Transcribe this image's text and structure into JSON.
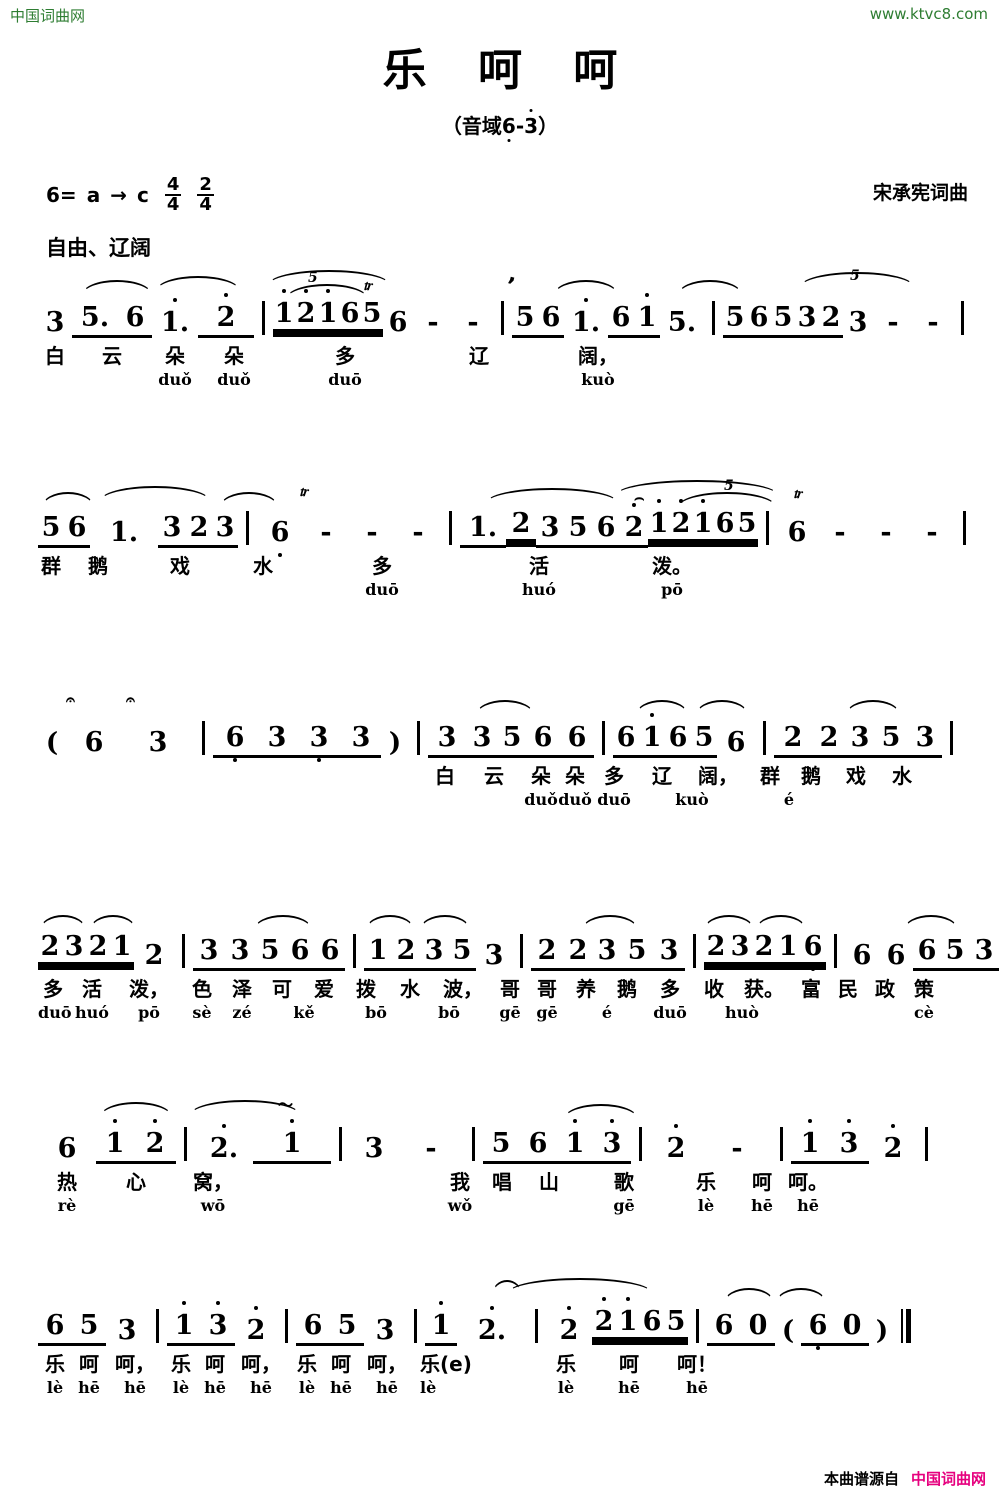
{
  "site": {
    "brand": "中国词曲网",
    "url": "www.ktvc8.com"
  },
  "score": {
    "title": "乐 呵 呵",
    "subtitle_prefix": "（音域",
    "subtitle_low": "6",
    "subtitle_dash": "-",
    "subtitle_high": "3",
    "subtitle_suffix": "）",
    "key": "6=",
    "key_from": "a",
    "key_arrow": "→",
    "key_to": "c",
    "meter1_num": "4",
    "meter1_den": "4",
    "meter2_num": "2",
    "meter2_den": "4",
    "credit": "宋承宪词曲",
    "tempo": "自由、辽阔"
  },
  "lines": [
    {
      "id": "line-1",
      "measures": [
        {
          "notes": [
            "3",
            "5.",
            "6",
            "1.",
            "2"
          ],
          "lyrics": [
            "白",
            "云",
            "朵",
            "",
            "朵"
          ],
          "pinyin": [
            "",
            "",
            "duǒ",
            "",
            "duǒ"
          ]
        },
        {
          "notes": [
            "1",
            "2",
            "1",
            "6",
            "5",
            "6",
            "-",
            "-"
          ],
          "lyrics": [],
          "pinyin": []
        },
        {
          "notes": [
            "5",
            "6",
            "1.",
            "6",
            "1",
            "5."
          ],
          "lyrics": [
            "多",
            "",
            "",
            "辽"
          ],
          "pinyin": [
            "duō",
            "",
            "",
            "kuò"
          ]
        },
        {
          "notes": [
            "5",
            "6",
            "5",
            "3",
            "2",
            "3",
            "-",
            "-"
          ],
          "lyrics": [
            "阔，"
          ],
          "pinyin": [
            "kuò"
          ]
        }
      ]
    },
    {
      "id": "line-2",
      "measures": [
        {
          "notes": [
            "5",
            "6",
            "1.",
            "3",
            "2",
            "3"
          ],
          "lyrics": [
            "群",
            "鹅",
            "戏"
          ],
          "pinyin": []
        },
        {
          "notes": [
            "6",
            "-",
            "-",
            "-"
          ],
          "lyrics": [
            "水"
          ],
          "pinyin": []
        },
        {
          "notes": [
            "1.",
            "2",
            "3",
            "5",
            "6",
            "2",
            "1",
            "2",
            "1",
            "6",
            "5"
          ],
          "lyrics": [
            "多",
            "活"
          ],
          "pinyin": [
            "duō",
            "huó"
          ]
        },
        {
          "notes": [
            "6",
            "-",
            "-",
            "-"
          ],
          "lyrics": [
            "泼。"
          ],
          "pinyin": [
            "pō"
          ]
        }
      ]
    },
    {
      "id": "line-3",
      "measures": [
        {
          "notes": [
            "(",
            "6",
            "3"
          ],
          "lyrics": [],
          "pinyin": []
        },
        {
          "notes": [
            "6",
            "3",
            "3",
            "3",
            ")"
          ],
          "lyrics": [],
          "pinyin": []
        },
        {
          "notes": [
            "3",
            "3",
            "5",
            "6",
            "6"
          ],
          "lyrics": [
            "白",
            "云",
            "朵",
            "朵"
          ],
          "pinyin": [
            "",
            "",
            "duǒ",
            "duǒ"
          ]
        },
        {
          "notes": [
            "6",
            "1",
            "6",
            "5",
            "6"
          ],
          "lyrics": [
            "多",
            "辽",
            "阔，"
          ],
          "pinyin": [
            "duō",
            "",
            "kuò"
          ]
        },
        {
          "notes": [
            "2",
            "2",
            "3",
            "5",
            "3"
          ],
          "lyrics": [
            "群",
            "鹅",
            "戏",
            "水"
          ],
          "pinyin": [
            "",
            "é",
            "",
            ""
          ]
        }
      ]
    },
    {
      "id": "line-4",
      "measures": [
        {
          "notes": [
            "2",
            "3",
            "2",
            "1",
            "2"
          ],
          "lyrics": [
            "多",
            "活",
            "泼，"
          ],
          "pinyin": [
            "duō",
            "huó",
            "pō"
          ]
        },
        {
          "notes": [
            "3",
            "3",
            "5",
            "6",
            "6"
          ],
          "lyrics": [
            "色",
            "泽",
            "可",
            "爱"
          ],
          "pinyin": [
            "sè",
            "zé",
            "kě",
            ""
          ]
        },
        {
          "notes": [
            "1",
            "2",
            "3",
            "5",
            "3"
          ],
          "lyrics": [
            "拨",
            "水",
            "波，"
          ],
          "pinyin": [
            "bō",
            "",
            "bō"
          ]
        },
        {
          "notes": [
            "2",
            "2",
            "3",
            "5",
            "3"
          ],
          "lyrics": [
            "哥",
            "哥",
            "养",
            "鹅"
          ],
          "pinyin": [
            "gē",
            "gē",
            "",
            "é"
          ]
        },
        {
          "notes": [
            "2",
            "3",
            "2",
            "1",
            "6"
          ],
          "lyrics": [
            "多",
            "收",
            "获。"
          ],
          "pinyin": [
            "duō",
            "",
            "huò"
          ]
        },
        {
          "notes": [
            "6",
            "6",
            "6",
            "5",
            "3"
          ],
          "lyrics": [
            "富",
            "民",
            "政",
            "策"
          ],
          "pinyin": [
            "",
            "",
            "",
            "cè"
          ]
        }
      ]
    },
    {
      "id": "line-5",
      "measures": [
        {
          "notes": [
            "6",
            "1",
            "2"
          ],
          "lyrics": [
            "热",
            "心"
          ],
          "pinyin": [
            "rè",
            ""
          ]
        },
        {
          "notes": [
            "2.",
            "1"
          ],
          "lyrics": [
            "窝，"
          ],
          "pinyin": [
            "wō"
          ]
        },
        {
          "notes": [
            "3",
            "-"
          ],
          "lyrics": [],
          "pinyin": []
        },
        {
          "notes": [
            "5",
            "6",
            "1",
            "3"
          ],
          "lyrics": [
            "我",
            "唱",
            "山"
          ],
          "pinyin": [
            "wǒ",
            "",
            ""
          ]
        },
        {
          "notes": [
            "2",
            "-"
          ],
          "lyrics": [
            "歌"
          ],
          "pinyin": [
            "gē"
          ]
        },
        {
          "notes": [
            "1",
            "3",
            "2"
          ],
          "lyrics": [
            "乐",
            "呵",
            "呵。"
          ],
          "pinyin": [
            "lè",
            "hē",
            "hē"
          ]
        }
      ]
    },
    {
      "id": "line-6",
      "measures": [
        {
          "notes": [
            "6",
            "5",
            "3"
          ],
          "lyrics": [
            "乐",
            "呵",
            "呵，"
          ],
          "pinyin": [
            "lè",
            "hē",
            "hē"
          ]
        },
        {
          "notes": [
            "1",
            "3",
            "2"
          ],
          "lyrics": [
            "乐",
            "呵",
            "呵，"
          ],
          "pinyin": [
            "lè",
            "hē",
            "hē"
          ]
        },
        {
          "notes": [
            "6",
            "5",
            "3"
          ],
          "lyrics": [
            "乐",
            "呵",
            "呵，"
          ],
          "pinyin": [
            "lè",
            "hē",
            "hē"
          ]
        },
        {
          "notes": [
            "1",
            "2."
          ],
          "lyrics": [
            "乐(e)"
          ],
          "pinyin": [
            "lè"
          ]
        },
        {
          "notes": [
            "2",
            "2",
            "1",
            "6",
            "5"
          ],
          "lyrics": [
            "乐",
            "呵"
          ],
          "pinyin": [
            "lè",
            "hē"
          ]
        },
        {
          "notes": [
            "6",
            "0",
            "(",
            "6",
            "0",
            ")"
          ],
          "lyrics": [
            "呵！"
          ],
          "pinyin": [
            "hē"
          ]
        }
      ]
    }
  ],
  "footer": {
    "source_label": "本曲谱源自",
    "brand": "中国词曲网"
  }
}
